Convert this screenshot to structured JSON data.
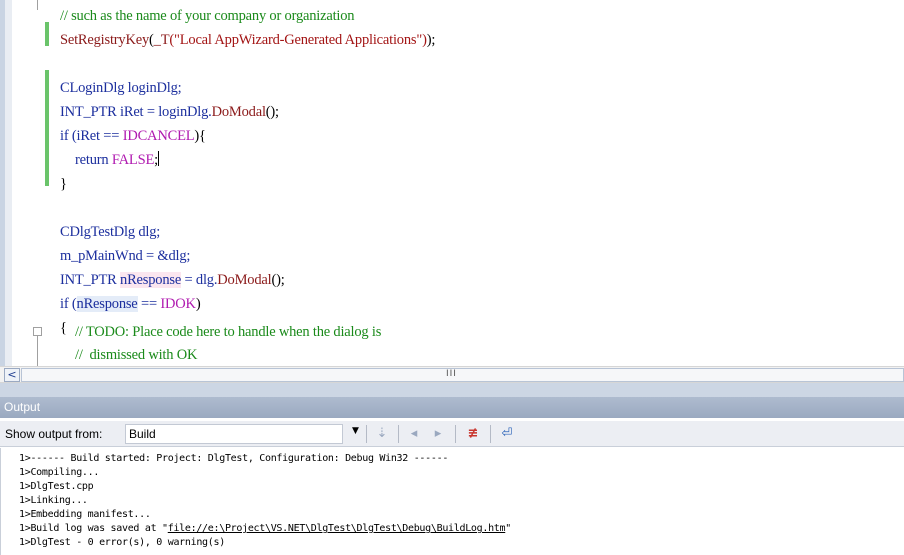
{
  "editor": {
    "lines": {
      "l01": "// such as the name of your company or organization",
      "l02_fn": "SetRegistryKey",
      "l02_a": "(",
      "l02_mac": "_T",
      "l02_str": "(\"Local AppWizard-Generated Applications\")",
      "l02_end": ");",
      "l04": "CLoginDlg loginDlg;",
      "l05_a": "INT_PTR iRet = loginDlg.",
      "l05_fn": "DoModal",
      "l05_end": "();",
      "l06_a": "if (iRet == ",
      "l06_mac": "IDCANCEL",
      "l06_end": "){",
      "l07_a": "return ",
      "l07_mac": "FALSE",
      "l07_end": ";",
      "l08": "}",
      "l10": "CDlgTestDlg dlg;",
      "l11": "m_pMainWnd = &dlg;",
      "l12_a": "INT_PTR ",
      "l12_var": "nResponse",
      "l12_b": " = dlg.",
      "l12_fn": "DoModal",
      "l12_end": "();",
      "l13_a": "if (",
      "l13_var": "nResponse",
      "l13_b": " == ",
      "l13_mac": "IDOK",
      "l13_end": ")",
      "l14": "{",
      "l15": "// TODO: Place code here to handle when the dialog is",
      "l16": "//  dismissed with OK"
    }
  },
  "scrollbar": {
    "left_arrow": "<",
    "grip": "III"
  },
  "output": {
    "title": "Output",
    "show_label": "Show output from:",
    "source_selected": "Build",
    "dropdown_arrow": "▼",
    "toolbar_icons": {
      "goto_icon": "⇣",
      "prev_icon": "◂",
      "next_icon": "▸",
      "clear_icon": "≢",
      "wrap_icon": "⏎"
    },
    "lines": [
      "1>------ Build started: Project: DlgTest, Configuration: Debug Win32 ------",
      "1>Compiling...",
      "1>DlgTest.cpp",
      "1>Linking...",
      "1>Embedding manifest...",
      "1>DlgTest - 0 error(s), 0 warning(s)"
    ],
    "buildlog_prefix": "1>Build log was saved at \"",
    "buildlog_link": "file://e:\\Project\\VS.NET\\DlgTest\\DlgTest\\Debug\\BuildLog.htm",
    "buildlog_suffix": "\""
  },
  "colors": {
    "comment": "#1a8a1a",
    "keyword": "#1c2f9e",
    "macro": "#b01ab0",
    "string": "#a31515",
    "output_title_bg": "#9aa9c0"
  }
}
